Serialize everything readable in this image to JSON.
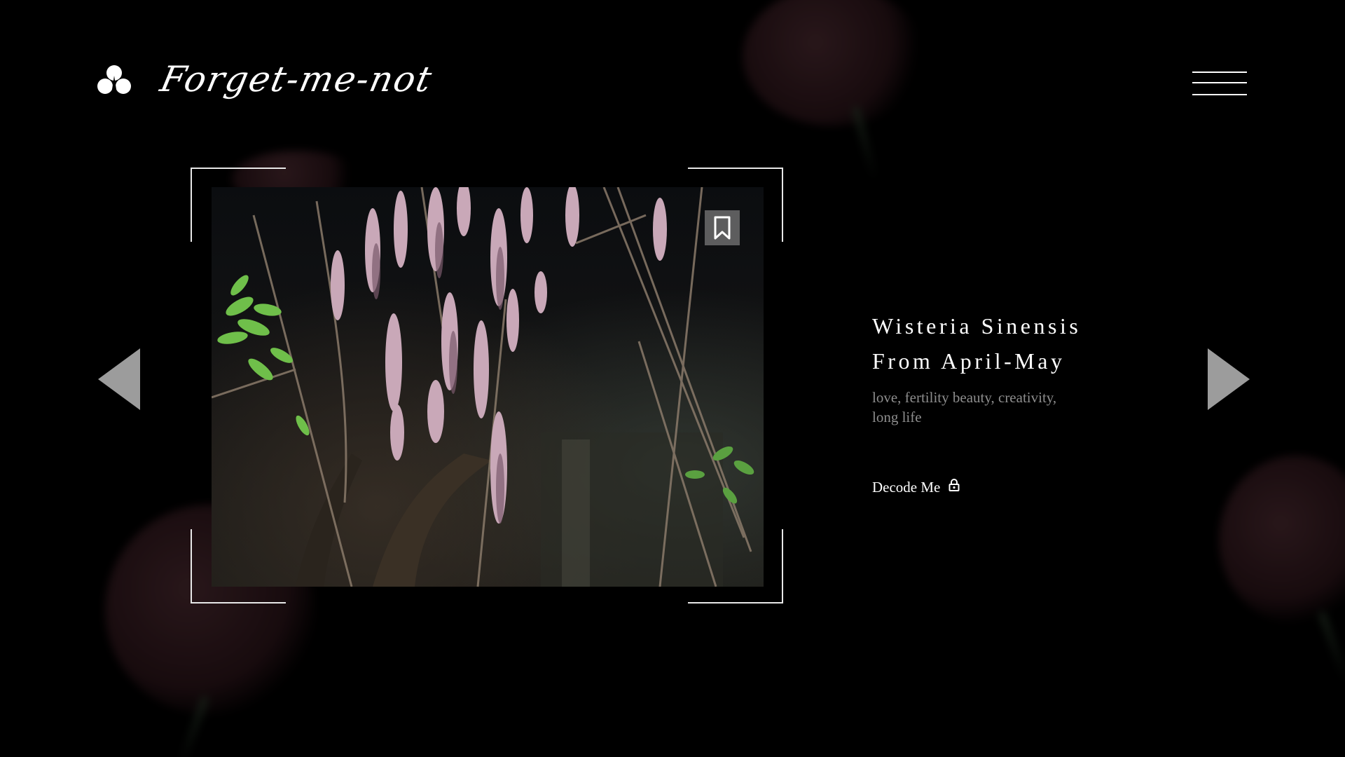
{
  "brand": {
    "name": "Forget-me-not",
    "logo_icon": "trefoil-blossom-icon"
  },
  "header": {
    "menu_icon": "hamburger-menu-icon"
  },
  "gallery": {
    "image_subject": "wisteria-branches-photo",
    "bookmark_icon": "bookmark-icon",
    "prev_icon": "triangle-left-icon",
    "next_icon": "triangle-right-icon"
  },
  "flower": {
    "name": "Wisteria Sinensis",
    "season": "From April-May",
    "meaning_line1": "love, fertility beauty, creativity,",
    "meaning_line2": "long life"
  },
  "decode": {
    "label": "Decode Me",
    "icon": "lock-icon"
  },
  "colors": {
    "background": "#000000",
    "text": "#ffffff",
    "muted_text": "#8d8d8d",
    "arrow": "#9c9c9c",
    "frame": "#e8e8e8"
  }
}
